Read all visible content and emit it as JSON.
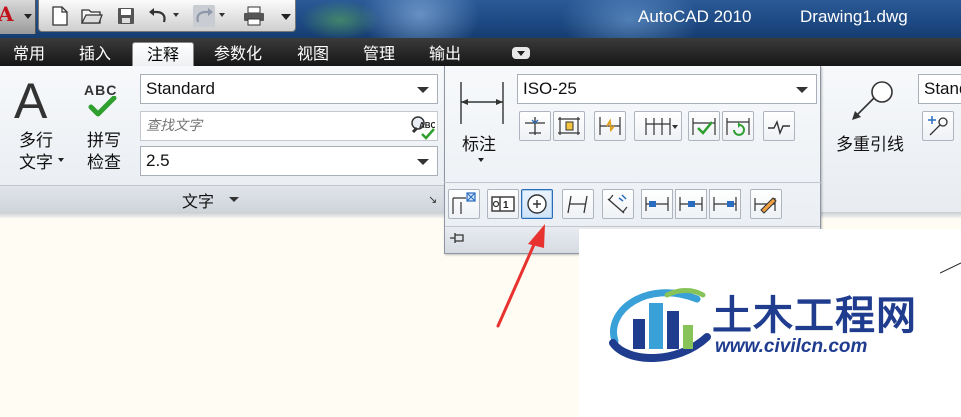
{
  "titlebar": {
    "app_title": "AutoCAD 2010",
    "doc_title": "Drawing1.dwg",
    "qat_icons": [
      "new-icon",
      "open-icon",
      "save-icon",
      "undo-icon",
      "redo-icon",
      "plot-icon",
      "customize-icon"
    ]
  },
  "tabs": [
    {
      "label": "常用",
      "active": false
    },
    {
      "label": "插入",
      "active": false
    },
    {
      "label": "注释",
      "active": true
    },
    {
      "label": "参数化",
      "active": false
    },
    {
      "label": "视图",
      "active": false
    },
    {
      "label": "管理",
      "active": false
    },
    {
      "label": "输出",
      "active": false
    }
  ],
  "text_panel": {
    "mtext_label_line1": "多行",
    "mtext_label_line2": "文字",
    "spell_abc": "ABC",
    "spell_label_line1": "拼写",
    "spell_label_line2": "检查",
    "text_style": "Standard",
    "find_placeholder": "查找文字",
    "text_height": "2.5",
    "footer_label": "文字",
    "launcher": "↘"
  },
  "dimension_panel": {
    "label": "标注",
    "dim_style": "ISO-25",
    "row1_tools": [
      "dimension-break-icon",
      "adjust-space-icon",
      "jog-line-icon",
      "continue-dimension-icon",
      "inspect-icon",
      "update-icon",
      "jogged-linear-icon"
    ],
    "row2_tools": [
      "tolerance-icon",
      "inspection-icon",
      "center-mark-icon",
      "oblique-icon",
      "text-angle-icon",
      "left-justify-icon",
      "center-justify-icon",
      "right-justify-icon",
      "override-icon"
    ],
    "selected_tool": "center-mark-icon"
  },
  "multileader_panel": {
    "label": "多重引线",
    "style": "Standard"
  },
  "watermark": {
    "name": "土木工程网",
    "url": "www.civilcn.com"
  },
  "colors": {
    "title_bar": "#1e4a84",
    "tab_bar": "#1c1c1c",
    "ribbon": "#eef1f5",
    "drawing_area": "#fffdf3",
    "arrow": "#e8322f",
    "watermark_blue": "#1f3c8f",
    "selection": "#2b6cb5"
  }
}
